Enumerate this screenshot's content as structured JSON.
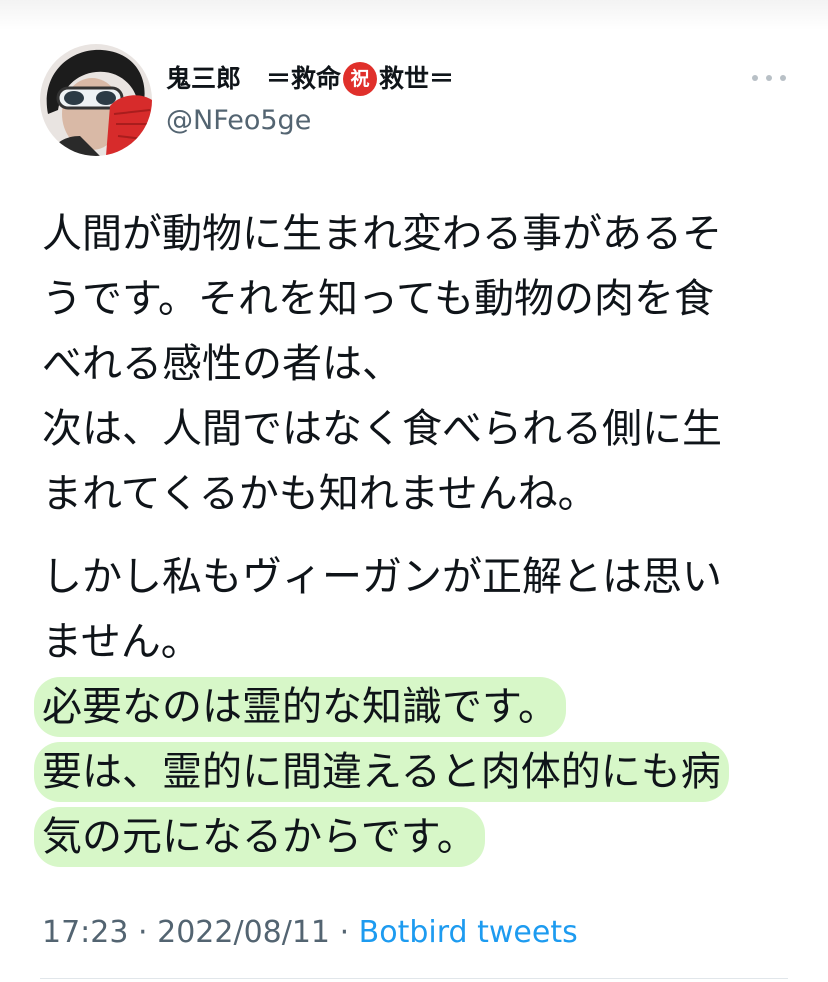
{
  "tweet": {
    "author": {
      "name_part1": "鬼三郎　＝救命",
      "badge": "祝",
      "name_part2": "救世＝",
      "handle": "@NFeo5ge"
    },
    "paragraph1": [
      "人間が動物に生まれ変わる事があるそ",
      "うです。それを知っても動物の肉を食",
      "べれる感性の者は、",
      "次は、人間ではなく食べられる側に生",
      "まれてくるかも知れませんね。"
    ],
    "paragraph2_plain": [
      "しかし私もヴィーガンが正解とは思い",
      "ません。"
    ],
    "paragraph2_highlighted": [
      "必要なのは霊的な知識です。",
      "要は、霊的に間違えると肉体的にも病",
      "気の元になるからです。"
    ],
    "highlight_color": "#d7f7c8",
    "time": "17:23",
    "separator": "·",
    "date": "2022/08/11",
    "source": "Botbird tweets",
    "link_color": "#1d9bf0",
    "more_icon": "more-horizontal-icon"
  }
}
